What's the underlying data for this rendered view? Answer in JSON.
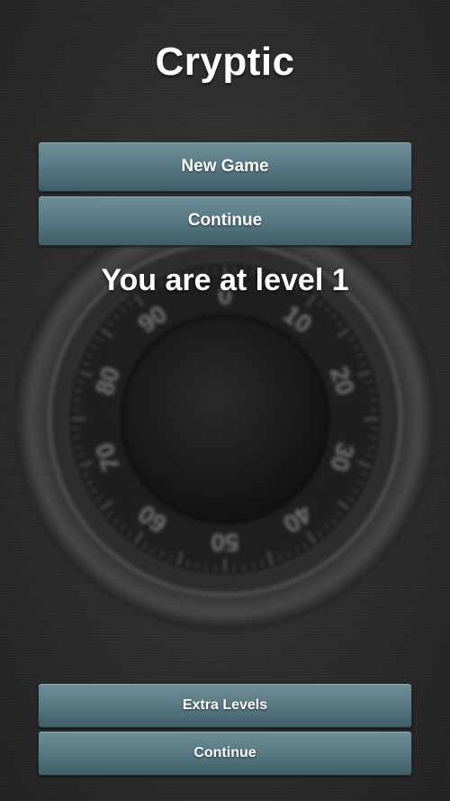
{
  "app": {
    "title": "Cryptic"
  },
  "menu": {
    "new_game_label": "New Game",
    "continue_label": "Continue"
  },
  "status": {
    "level_text": "You are at level 1"
  },
  "footer_menu": {
    "extra_levels_label": "Extra Levels",
    "continue_label": "Continue"
  },
  "background": {
    "image": "safe-combination-dial-icon",
    "dial_numbers": [
      "0",
      "10",
      "20",
      "30",
      "40",
      "50",
      "60",
      "70",
      "80",
      "90"
    ]
  },
  "colors": {
    "button_top": "#6f8f98",
    "button_bottom": "#3f5e68",
    "background": "#2b2b2b",
    "text": "#ffffff"
  }
}
